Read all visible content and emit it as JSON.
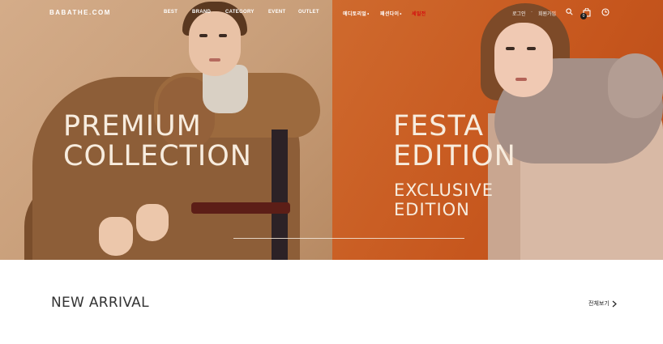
{
  "header": {
    "logo": "BABATHE.COM",
    "nav": {
      "best": "BEST",
      "brand": "BRAND",
      "category": "CATEGORY",
      "event": "EVENT",
      "outlet": "OUTLET",
      "editorial": "에디토리얼",
      "fashion_diary": "패션다이",
      "sale": "세일전"
    },
    "util": {
      "login": "로그인",
      "signup": "회원가입",
      "separator": "·",
      "cart_count": "0"
    },
    "icons": [
      "search-icon",
      "bag-icon",
      "clock-icon"
    ]
  },
  "hero": {
    "left": {
      "heading": "PREMIUM\nCOLLECTION"
    },
    "right": {
      "heading": "FESTA\nEDITION",
      "subheading": "EXCLUSIVE\nEDITION"
    }
  },
  "new_arrival": {
    "title": "NEW ARRIVAL",
    "view_all": "전체보기"
  },
  "colors": {
    "left_panel": "#c89e79",
    "right_panel": "#c6561d",
    "hero_text": "#f7ecde",
    "sale_accent": "#d40f0f"
  }
}
